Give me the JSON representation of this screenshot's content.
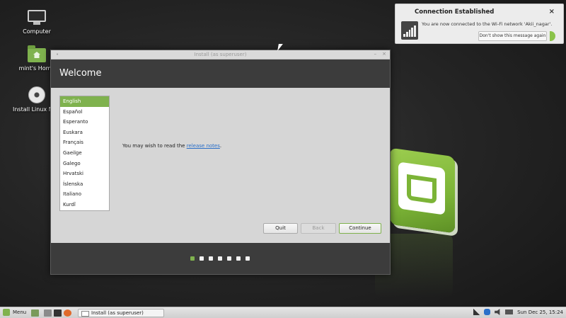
{
  "desktop": {
    "icons": [
      {
        "label": "Computer",
        "icon": "computer-icon"
      },
      {
        "label": "mint's Home",
        "icon": "home-folder-icon"
      },
      {
        "label": "Install Linux Mint",
        "icon": "disc-icon"
      }
    ]
  },
  "notification": {
    "title": "Connection Established",
    "body": "You are now connected to the Wi-Fi network 'Akii_nagar'.",
    "button": "Don't show this message again",
    "close": "×",
    "icon": "wifi-signal-icon"
  },
  "installer": {
    "title": "Install (as superuser)",
    "heading": "Welcome",
    "intro_text": "You may wish to read the ",
    "intro_link": "release notes",
    "intro_end": ".",
    "languages": [
      "English",
      "Español",
      "Esperanto",
      "Euskara",
      "Français",
      "Gaeilge",
      "Galego",
      "Hrvatski",
      "Íslenska",
      "Italiano",
      "Kurdî"
    ],
    "selected_language": "English",
    "buttons": {
      "quit": "Quit",
      "back": "Back",
      "continue": "Continue"
    },
    "steps_total": 7,
    "step_current": 1,
    "title_dot": "•",
    "minimize": "–",
    "close": "×"
  },
  "taskbar": {
    "menu_label": "Menu",
    "task_label": "Install (as superuser)",
    "clock": "Sun Dec 25, 15:24",
    "accent": "#7fb24e"
  }
}
